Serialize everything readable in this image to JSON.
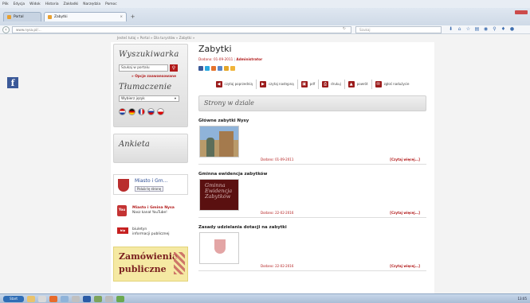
{
  "browser": {
    "menu": [
      "Plik",
      "Edycja",
      "Widok",
      "Historia",
      "Zakładki",
      "Narzędzia",
      "Pomoc"
    ],
    "tabs": [
      {
        "label": "Portal"
      },
      {
        "label": "Zabytki"
      }
    ],
    "tab_close": "×",
    "new_tab": "+",
    "address": "www.nysa.pl/...",
    "search_placeholder": "Szukaj",
    "toolbar_icons": [
      "download-icon",
      "home-icon",
      "star-icon",
      "bookmark-icon",
      "pocket-icon",
      "share-icon",
      "shield-icon",
      "firefox-icon"
    ]
  },
  "page": {
    "breadcrumb": "Jesteś tutaj » Portal » Dla turystów » Zabytki »",
    "facebook_icon_label": "f",
    "sidebar": {
      "search_title": "Wyszukiwarka",
      "search_value": "Szukaj w portalu",
      "advanced_link": "» Opcje zaawansowane",
      "translate_title": "Tłumaczenie",
      "language_select": "Wybierz język",
      "poll_title": "Ankieta",
      "fb_name": "Miasto i Gm...",
      "fb_like": "Polub tę stronę",
      "youtube_icon_label": "You",
      "youtube_title": "Miasto i Gmina Nysa",
      "youtube_sub": "Nasz kanał YouTube!",
      "bip_icon_label": "bip",
      "bip_line1": "biuletyn",
      "bip_line2": "informacji publicznej",
      "banner_line1": "Zamówienia",
      "banner_line2": "publiczne"
    },
    "main": {
      "title": "Zabytki",
      "meta_date": "Dodano: 01-09-2011",
      "meta_author": "Administrator",
      "actions": [
        {
          "icon": "◀",
          "label": "czytaj poprzednią"
        },
        {
          "icon": "▶",
          "label": "czytaj następną"
        },
        {
          "icon": "▣",
          "label": "pdf"
        },
        {
          "icon": "⎙",
          "label": "drukuj"
        },
        {
          "icon": "▲",
          "label": "powrót"
        },
        {
          "icon": "✉",
          "label": "zgłoś nadużycie"
        }
      ],
      "section_title": "Strony w dziale",
      "items": [
        {
          "title": "Główne zabytki Nysy",
          "date": "Dodano: 01-09-2011",
          "more": "[Czytaj więcej...]"
        },
        {
          "title": "Gminna ewidencja zabytków",
          "thumb_text": "Gminna Ewidencja Zabytków",
          "date": "Dodano: 22-02-2016",
          "more": "[Czytaj więcej...]"
        },
        {
          "title": "Zasady udzielania dotacji na zabytki",
          "date": "Dodano: 22-02-2016",
          "more": "[Czytaj więcej...]"
        }
      ]
    }
  },
  "taskbar": {
    "start": "Start",
    "tray_time": "13:05"
  }
}
